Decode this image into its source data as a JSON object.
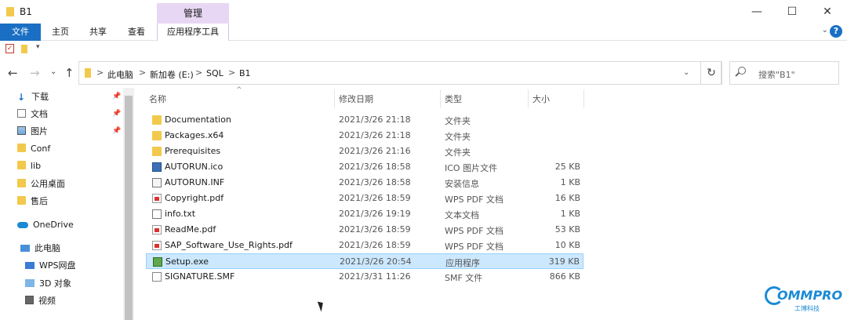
{
  "window": {
    "title": "B1",
    "context_tab_header": "管理",
    "minimize": "—",
    "maximize": "☐",
    "close": "✕"
  },
  "ribbon": {
    "tabs": [
      "文件",
      "主页",
      "共享",
      "查看",
      "应用程序工具"
    ],
    "collapse": "⌄",
    "help": "?"
  },
  "qat": {
    "check": "✓",
    "dropdown": "▾"
  },
  "nav_buttons": {
    "back": "←",
    "forward": "→",
    "dropdown": "⌄",
    "up": "↑"
  },
  "address": {
    "crumbs": [
      "此电脑",
      "新加卷 (E:)",
      "SQL",
      "B1"
    ],
    "sep": ">",
    "dropdown": "⌄",
    "refresh": "↻"
  },
  "search": {
    "placeholder": "搜索\"B1\""
  },
  "nav_pane": {
    "items": [
      {
        "label": "下载",
        "icon": "download-icon",
        "pinned": true
      },
      {
        "label": "文档",
        "icon": "document-icon",
        "pinned": true
      },
      {
        "label": "图片",
        "icon": "picture-icon",
        "pinned": true
      },
      {
        "label": "Conf",
        "icon": "folder-icon",
        "pinned": false
      },
      {
        "label": "lib",
        "icon": "folder-icon",
        "pinned": false
      },
      {
        "label": "公用桌面",
        "icon": "folder-icon",
        "pinned": false
      },
      {
        "label": "售后",
        "icon": "folder-icon",
        "pinned": false
      },
      {
        "label": "OneDrive",
        "icon": "cloud-icon",
        "pinned": false
      },
      {
        "label": "此电脑",
        "icon": "computer-icon",
        "pinned": false
      },
      {
        "label": "WPS网盘",
        "icon": "wps-drive-icon",
        "pinned": false
      },
      {
        "label": "3D 对象",
        "icon": "3d-objects-icon",
        "pinned": false
      },
      {
        "label": "视频",
        "icon": "video-icon",
        "pinned": false
      }
    ],
    "pin_glyph": "📌"
  },
  "file_list": {
    "columns": {
      "name": "名称",
      "date": "修改日期",
      "type": "类型",
      "size": "大小"
    },
    "sort_arrow": "^",
    "rows": [
      {
        "name": "Documentation",
        "date": "2021/3/26 21:18",
        "type": "文件夹",
        "size": "",
        "icon": "folder-icon",
        "selected": false
      },
      {
        "name": "Packages.x64",
        "date": "2021/3/26 21:18",
        "type": "文件夹",
        "size": "",
        "icon": "folder-icon",
        "selected": false
      },
      {
        "name": "Prerequisites",
        "date": "2021/3/26 21:16",
        "type": "文件夹",
        "size": "",
        "icon": "folder-icon",
        "selected": false
      },
      {
        "name": "AUTORUN.ico",
        "date": "2021/3/26 18:58",
        "type": "ICO 图片文件",
        "size": "25 KB",
        "icon": "ico-file-icon",
        "selected": false
      },
      {
        "name": "AUTORUN.INF",
        "date": "2021/3/26 18:58",
        "type": "安装信息",
        "size": "1 KB",
        "icon": "inf-file-icon",
        "selected": false
      },
      {
        "name": "Copyright.pdf",
        "date": "2021/3/26 18:59",
        "type": "WPS PDF 文档",
        "size": "16 KB",
        "icon": "pdf-file-icon",
        "selected": false
      },
      {
        "name": "info.txt",
        "date": "2021/3/26 19:19",
        "type": "文本文档",
        "size": "1 KB",
        "icon": "txt-file-icon",
        "selected": false
      },
      {
        "name": "ReadMe.pdf",
        "date": "2021/3/26 18:59",
        "type": "WPS PDF 文档",
        "size": "53 KB",
        "icon": "pdf-file-icon",
        "selected": false
      },
      {
        "name": "SAP_Software_Use_Rights.pdf",
        "date": "2021/3/26 18:59",
        "type": "WPS PDF 文档",
        "size": "10 KB",
        "icon": "pdf-file-icon",
        "selected": false
      },
      {
        "name": "Setup.exe",
        "date": "2021/3/26 20:54",
        "type": "应用程序",
        "size": "319 KB",
        "icon": "exe-file-icon",
        "selected": true
      },
      {
        "name": "SIGNATURE.SMF",
        "date": "2021/3/31 11:26",
        "type": "SMF 文件",
        "size": "866 KB",
        "icon": "smf-file-icon",
        "selected": false
      }
    ]
  },
  "watermark": {
    "brand": "OMMPRO",
    "sub": "工博科技"
  },
  "colors": {
    "accent": "#1a6fc4",
    "context_tab": "#e8d7f4",
    "selection": "#cce8ff",
    "folder": "#f2c94c"
  }
}
